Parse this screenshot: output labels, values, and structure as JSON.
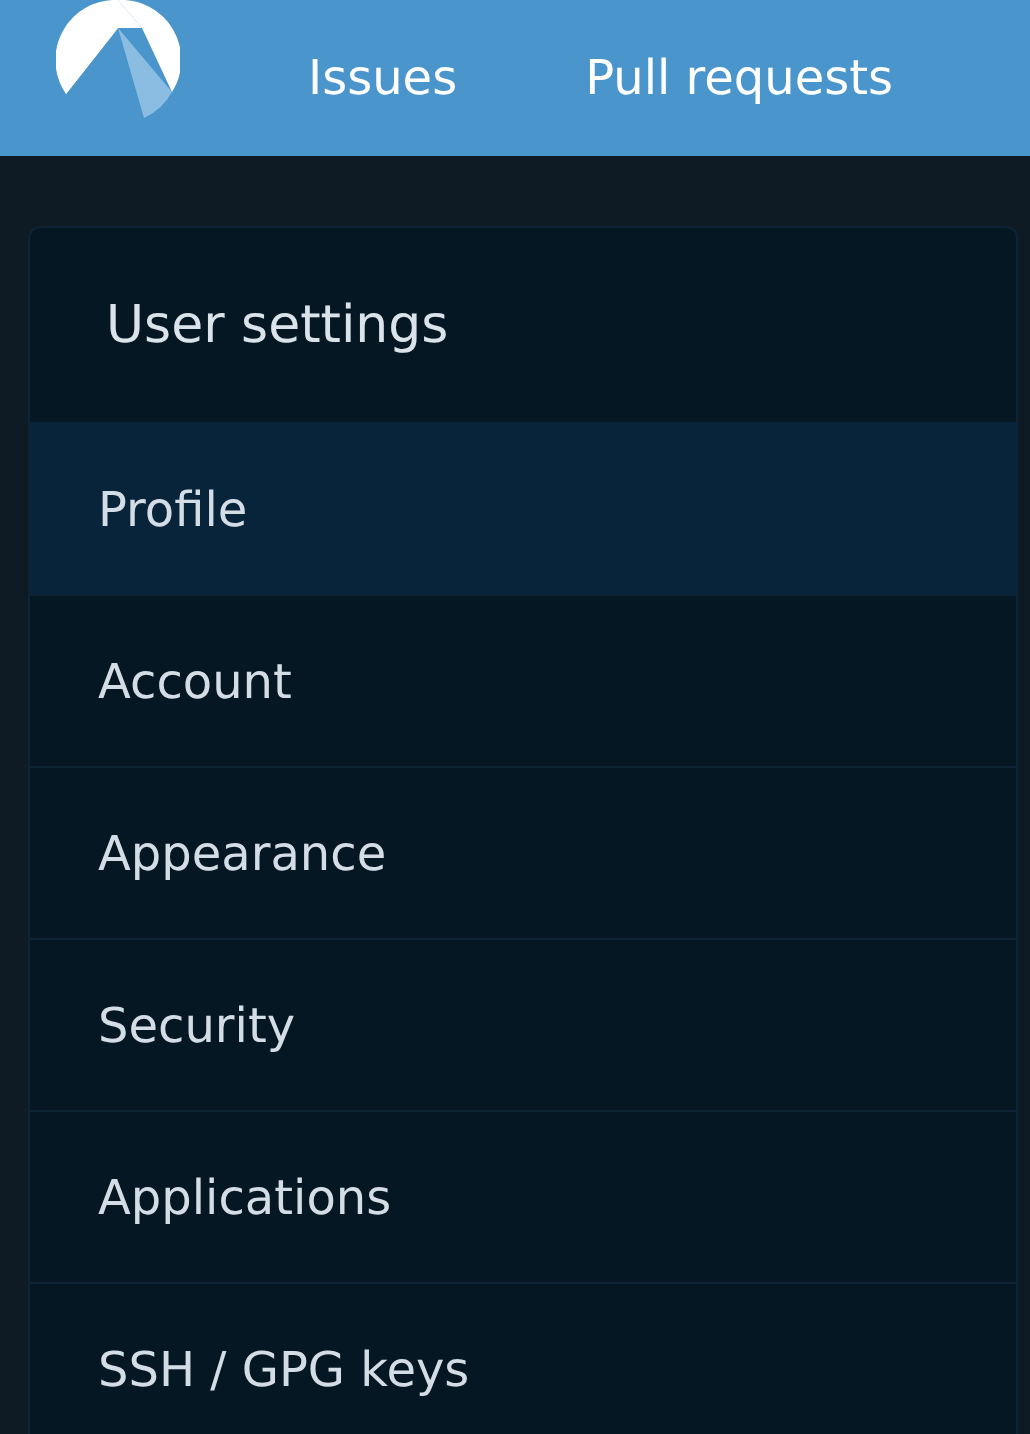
{
  "nav": {
    "links": [
      "Issues",
      "Pull requests"
    ]
  },
  "settings_menu": {
    "title": "User settings",
    "items": [
      {
        "label": "Profile",
        "selected": true
      },
      {
        "label": "Account",
        "selected": false
      },
      {
        "label": "Appearance",
        "selected": false
      },
      {
        "label": "Security",
        "selected": false
      },
      {
        "label": "Applications",
        "selected": false
      },
      {
        "label": "SSH / GPG keys",
        "selected": false
      }
    ]
  }
}
